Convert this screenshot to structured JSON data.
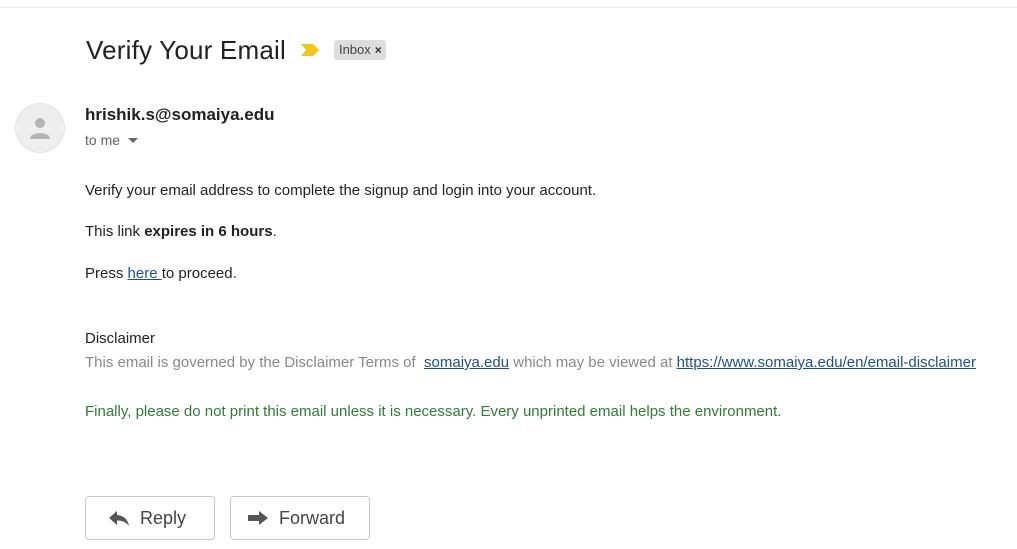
{
  "email": {
    "subject": "Verify Your Email",
    "label": "Inbox",
    "label_remove_glyph": "×",
    "sender": "hrishik.s@somaiya.edu",
    "recipient": "to me",
    "body": {
      "line1": "Verify your email address to complete the signup and login into your account.",
      "line2_prefix": "This link ",
      "line2_bold": "expires in 6 hours",
      "line2_suffix": ".",
      "line3_prefix": "Press ",
      "line3_link": "here ",
      "line3_suffix": "to proceed."
    },
    "disclaimer": {
      "title": "Disclaimer",
      "text_prefix": "This email is governed by the Disclaimer Terms of  ",
      "link1": "somaiya.edu",
      "text_middle": " which may be viewed at ",
      "link2": "https://www.somaiya.edu/en/email-disclaimer"
    },
    "environment_note": "Finally, please do not print this email unless it is necessary. Every unprinted email helps the environment."
  },
  "actions": {
    "reply_label": "Reply",
    "forward_label": "Forward"
  },
  "icons": {
    "importance": "importance-marker-icon",
    "avatar": "default-person-icon",
    "reply": "reply-arrow-icon",
    "forward": "forward-arrow-icon"
  },
  "colors": {
    "importance": "#f5c518",
    "link": "#15509e",
    "environment_note": "#2e7d32",
    "disclaimer_text": "#888888"
  }
}
